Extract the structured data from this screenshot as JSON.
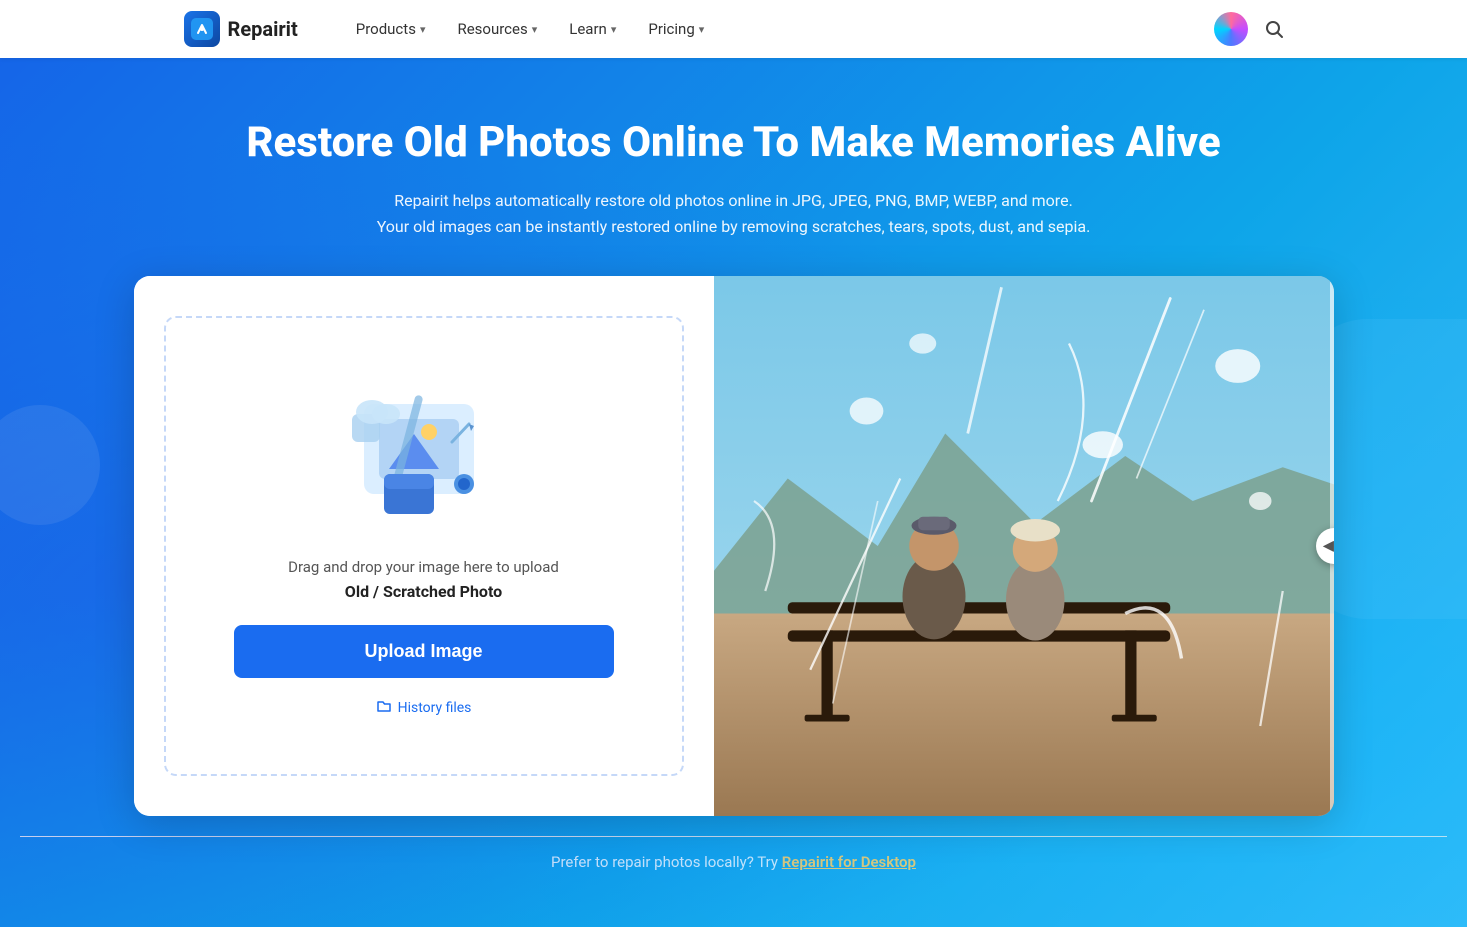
{
  "navbar": {
    "logo_text": "Repairit",
    "logo_icon": "🔧",
    "nav_items": [
      {
        "label": "Products",
        "has_chevron": true
      },
      {
        "label": "Resources",
        "has_chevron": true
      },
      {
        "label": "Learn",
        "has_chevron": true
      },
      {
        "label": "Pricing",
        "has_chevron": true
      }
    ],
    "search_icon": "🔍"
  },
  "hero": {
    "title": "Restore Old Photos Online To Make Memories Alive",
    "subtitle_line1": "Repairit helps automatically restore old photos online in JPG, JPEG, PNG, BMP, WEBP, and more.",
    "subtitle_line2": "Your old images can be instantly restored online by removing scratches, tears, spots, dust, and sepia."
  },
  "upload": {
    "drag_text": "Drag and drop your image here to upload",
    "photo_type": "Old / Scratched Photo",
    "button_label": "Upload Image",
    "history_label": "History files"
  },
  "footer": {
    "text": "Prefer to repair photos locally? Try ",
    "link_text": "Repairit for Desktop"
  }
}
